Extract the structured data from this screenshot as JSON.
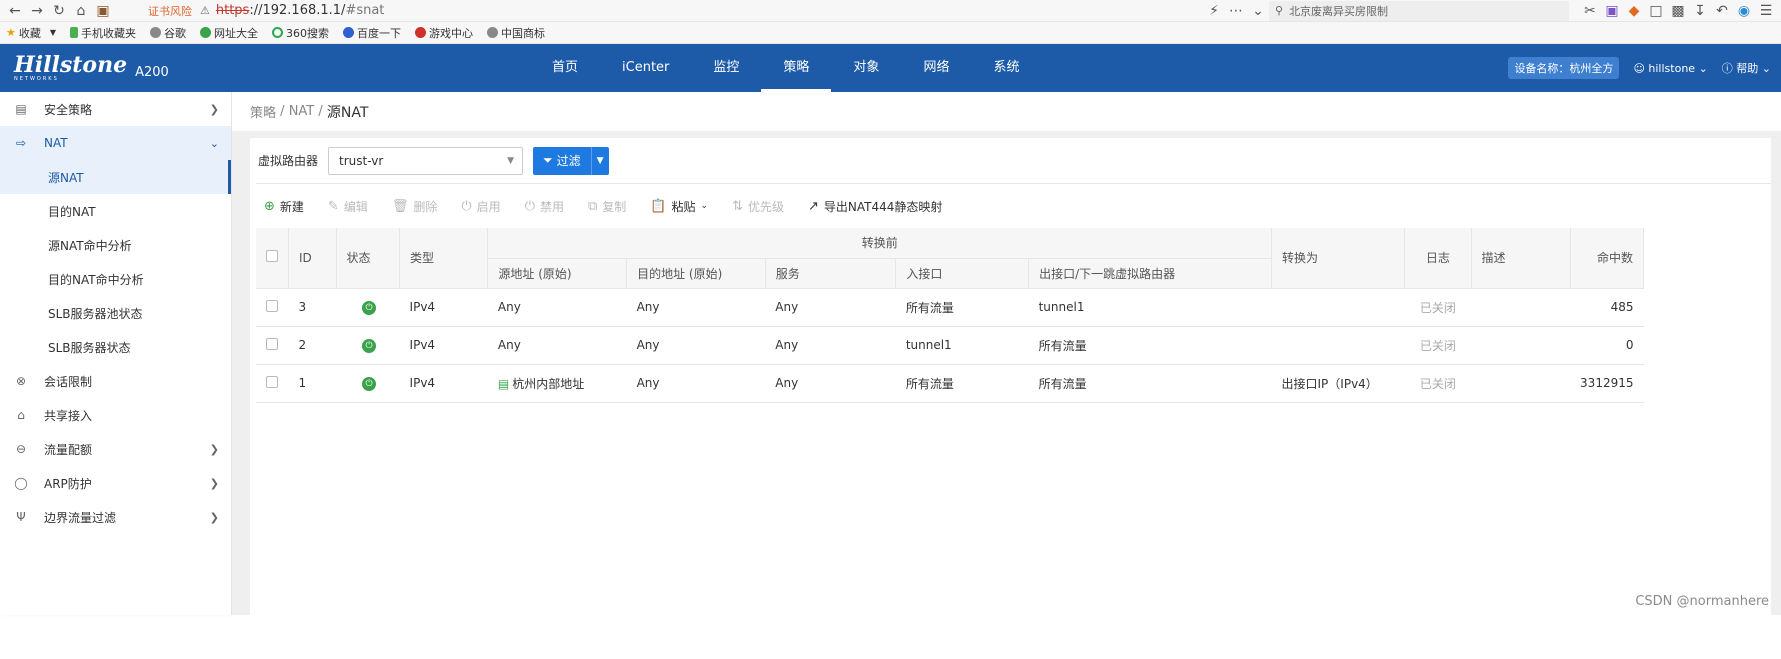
{
  "browser": {
    "cert_warning": "证书风险",
    "url_scheme": "https",
    "url_host": "://192.168.1.1/",
    "url_path": "#snat",
    "search_placeholder": "北京废离异买房限制",
    "bookmarks": [
      "收藏",
      "手机收藏夹",
      "谷歌",
      "网址大全",
      "360搜索",
      "百度一下",
      "游戏中心",
      "中国商标"
    ]
  },
  "header": {
    "brand": "Hillstone",
    "brand_sub": "NETWORKS",
    "model": "A200",
    "nav": [
      "首页",
      "iCenter",
      "监控",
      "策略",
      "对象",
      "网络",
      "系统"
    ],
    "active_nav": "策略",
    "device_badge": "设备名称：杭州全方",
    "user": "hillstone",
    "help": "帮助"
  },
  "sidebar": {
    "items": [
      {
        "label": "安全策略",
        "icon": "policy-icon"
      },
      {
        "label": "NAT",
        "icon": "nat-icon"
      },
      {
        "label": "源NAT"
      },
      {
        "label": "目的NAT"
      },
      {
        "label": "源NAT命中分析"
      },
      {
        "label": "目的NAT命中分析"
      },
      {
        "label": "SLB服务器池状态"
      },
      {
        "label": "SLB服务器状态"
      },
      {
        "label": "会话限制",
        "icon": "session-icon"
      },
      {
        "label": "共享接入",
        "icon": "share-icon"
      },
      {
        "label": "流量配额",
        "icon": "quota-icon"
      },
      {
        "label": "ARP防护",
        "icon": "arp-icon"
      },
      {
        "label": "边界流量过滤",
        "icon": "filter-icon"
      }
    ]
  },
  "breadcrumb": {
    "part1": "策略",
    "sep": "/",
    "part2": "NAT",
    "current": "源NAT"
  },
  "filter": {
    "label": "虚拟路由器",
    "value": "trust-vr",
    "button": "过滤"
  },
  "actions": {
    "new": "新建",
    "edit": "编辑",
    "delete": "删除",
    "enable": "启用",
    "disable": "禁用",
    "copy": "复制",
    "paste": "粘贴",
    "priority": "优先级",
    "export": "导出NAT444静态映射"
  },
  "table": {
    "headers": {
      "id": "ID",
      "status": "状态",
      "type": "类型",
      "group": "转换前",
      "src": "源地址 (原始)",
      "dst": "目的地址 (原始)",
      "service": "服务",
      "ingress": "入接口",
      "egress": "出接口/下一跳虚拟路由器",
      "translate": "转换为",
      "log": "日志",
      "desc": "描述",
      "hits": "命中数"
    },
    "rows": [
      {
        "id": "3",
        "type": "IPv4",
        "src": "Any",
        "dst": "Any",
        "service": "Any",
        "ingress": "所有流量",
        "egress": "tunnel1",
        "translate": "",
        "log": "已关闭",
        "desc": "",
        "hits": "485"
      },
      {
        "id": "2",
        "type": "IPv4",
        "src": "Any",
        "dst": "Any",
        "service": "Any",
        "ingress": "tunnel1",
        "egress": "所有流量",
        "translate": "",
        "log": "已关闭",
        "desc": "",
        "hits": "0"
      },
      {
        "id": "1",
        "type": "IPv4",
        "src": "杭州内部地址",
        "dst": "Any",
        "service": "Any",
        "ingress": "所有流量",
        "egress": "所有流量",
        "translate": "出接口IP（IPv4）",
        "log": "已关闭",
        "desc": "",
        "hits": "3312915"
      }
    ]
  },
  "watermark": "CSDN @normanhere",
  "colors": {
    "brand": "#1d5aa8",
    "accent": "#1e7ae0",
    "status_on": "#3aa34a"
  }
}
